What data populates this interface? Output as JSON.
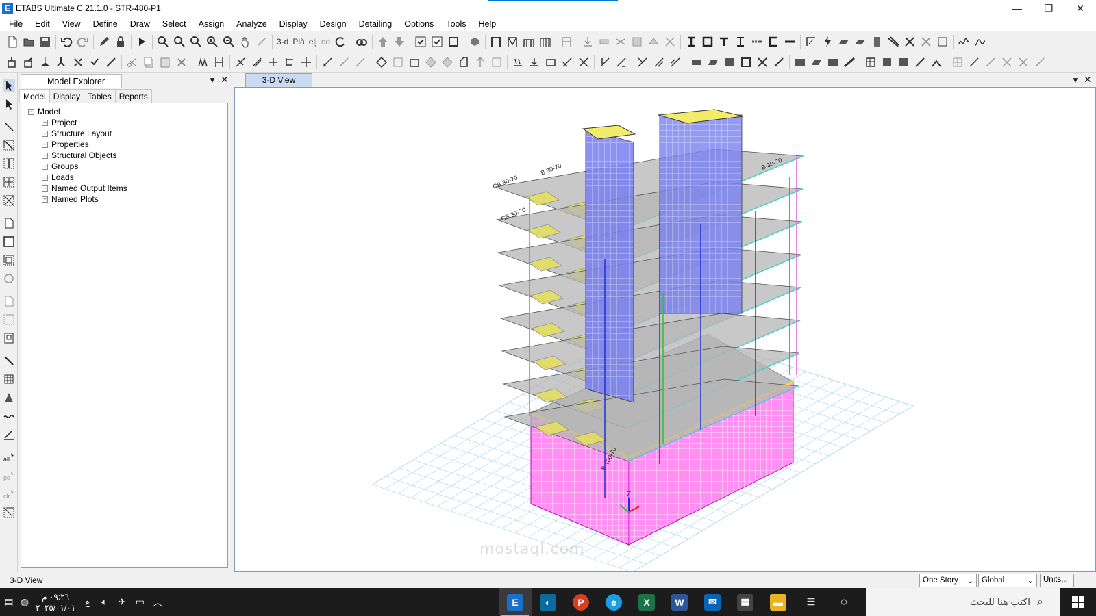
{
  "window": {
    "title": "ETABS Ultimate C 21.1.0 - STR-480-P1",
    "logo": "E",
    "minimize": "—",
    "restore": "❐",
    "close": "✕"
  },
  "menu": [
    "File",
    "Edit",
    "View",
    "Define",
    "Draw",
    "Select",
    "Assign",
    "Analyze",
    "Display",
    "Design",
    "Detailing",
    "Options",
    "Tools",
    "Help"
  ],
  "toolbar": {
    "view_3d_label": "3-d",
    "plan_label": "Plà",
    "elev_label": "elj",
    "nd_label": "nd"
  },
  "explorer": {
    "title": "Model Explorer",
    "tabs": [
      "Model",
      "Display",
      "Tables",
      "Reports"
    ],
    "root": "Model",
    "items": [
      "Project",
      "Structure Layout",
      "Properties",
      "Structural Objects",
      "Groups",
      "Loads",
      "Named Output Items",
      "Named Plots"
    ]
  },
  "view": {
    "tab_label": "3-D View",
    "axis_z": "Z"
  },
  "status": {
    "text": "3-D View",
    "story_select": "One Story",
    "coord_select": "Global",
    "units_button": "Units..."
  },
  "taskbar": {
    "time": "٠٩:٢٦ م",
    "date": "٢٠٢٥/٠١/٠١",
    "lang": "ع",
    "search_placeholder": "اكتب هنا للبحث"
  },
  "watermark": "mostaql.com",
  "model_labels": {
    "cb": "CB 30-70",
    "b30": "B 30-70",
    "b100": "B 100-70"
  },
  "colors": {
    "slab": "#b5b5b5",
    "beam_cyan": "#3fd0d0",
    "core_wall": "#7a7ff0",
    "opening": "#e6e05a",
    "base_wall": "#ff7ff0",
    "grid": "#9fd0f0",
    "column_blue": "#2030d0",
    "column_green": "#30c030"
  }
}
